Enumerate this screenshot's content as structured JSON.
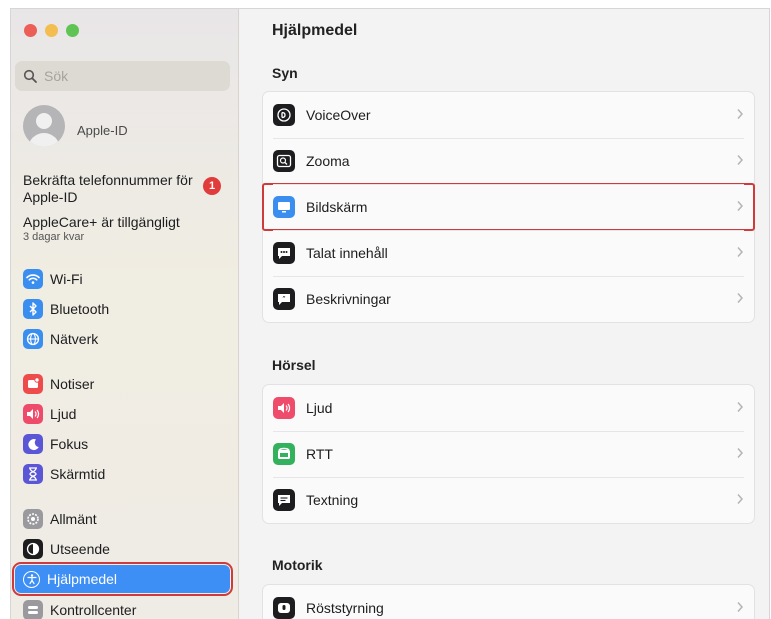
{
  "sidebar": {
    "search_placeholder": "Sök",
    "account_label": "Apple-ID",
    "confirm_phone": "Bekräfta telefonnummer för Apple-ID",
    "badge_count": "1",
    "applecare_title": "AppleCare+ är tillgängligt",
    "applecare_sub": "3 dagar kvar",
    "items": [
      {
        "label": "Wi-Fi",
        "icon": "wifi-icon",
        "color": "#3a8ef0"
      },
      {
        "label": "Bluetooth",
        "icon": "bluetooth-icon",
        "color": "#3a8ef0"
      },
      {
        "label": "Nätverk",
        "icon": "globe-icon",
        "color": "#3a8ef0"
      },
      {
        "label": "Notiser",
        "icon": "bell-icon",
        "color": "#ee4c4c"
      },
      {
        "label": "Ljud",
        "icon": "speaker-icon",
        "color": "#ee4b6b"
      },
      {
        "label": "Fokus",
        "icon": "moon-icon",
        "color": "#5b56d6"
      },
      {
        "label": "Skärmtid",
        "icon": "hourglass-icon",
        "color": "#5b56d6"
      },
      {
        "label": "Allmänt",
        "icon": "gear-icon",
        "color": "#9a9a9e"
      },
      {
        "label": "Utseende",
        "icon": "appearance-icon",
        "color": "#1d1d1f"
      },
      {
        "label": "Hjälpmedel",
        "icon": "accessibility-icon",
        "color": "#3a8ef0"
      },
      {
        "label": "Kontrollcenter",
        "icon": "control-center-icon",
        "color": "#9a9a9e"
      }
    ]
  },
  "main": {
    "title": "Hjälpmedel",
    "sections": [
      {
        "title": "Syn",
        "rows": [
          "VoiceOver",
          "Zooma",
          "Bildskärm",
          "Talat innehåll",
          "Beskrivningar"
        ]
      },
      {
        "title": "Hörsel",
        "rows": [
          "Ljud",
          "RTT",
          "Textning"
        ]
      },
      {
        "title": "Motorik",
        "rows": [
          "Röststyrning"
        ]
      }
    ]
  }
}
